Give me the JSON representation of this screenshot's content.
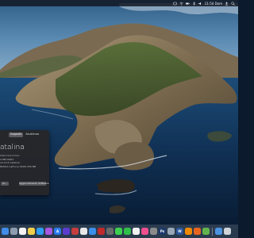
{
  "menubar": {
    "status_icons": [
      "control-icon",
      "wifi-icon",
      "battery-icon",
      "bluetooth-icon",
      "volume-icon",
      "user-icon",
      "spotlight-icon"
    ],
    "clock": "11:54 Dom"
  },
  "about_window": {
    "tabs": [
      "Supporto",
      "Assistenza"
    ],
    "os_name": "atalina",
    "specs": [
      "Intel Core 2 Duo",
      "4 MB DDR3",
      "10.15.6 Catalina",
      "NVIDIA GeForce 320M 256 MB"
    ],
    "button_report": "ts...",
    "button_update": "Aggiornamento Software..."
  },
  "dock": {
    "apps": [
      {
        "name": "finder",
        "color": "#3f8de8",
        "glyph": ""
      },
      {
        "name": "launchpad",
        "color": "#8f9db0",
        "glyph": ""
      },
      {
        "name": "calendar",
        "color": "#f4f4f4",
        "glyph": ""
      },
      {
        "name": "notes",
        "color": "#f0cf4a",
        "glyph": ""
      },
      {
        "name": "safari",
        "color": "#2f9df2",
        "glyph": ""
      },
      {
        "name": "podcasts",
        "color": "#a658e0",
        "glyph": ""
      },
      {
        "name": "app-store",
        "color": "#2a7cf0",
        "glyph": "A"
      },
      {
        "name": "siri",
        "color": "#5a3ccf",
        "glyph": ""
      },
      {
        "name": "photo-booth",
        "color": "#c53d3d",
        "glyph": ""
      },
      {
        "name": "chrome",
        "color": "#e8e8e8",
        "glyph": ""
      },
      {
        "name": "mail",
        "color": "#3a8ee8",
        "glyph": ""
      },
      {
        "name": "filezilla",
        "color": "#c02a2a",
        "glyph": ""
      },
      {
        "name": "grid",
        "color": "#6a6a6a",
        "glyph": ""
      },
      {
        "name": "messages",
        "color": "#3bd04f",
        "glyph": ""
      },
      {
        "name": "facetime",
        "color": "#2fbf4a",
        "glyph": ""
      },
      {
        "name": "photos",
        "color": "#f2f2f2",
        "glyph": ""
      },
      {
        "name": "itunes",
        "color": "#ef4f8f",
        "glyph": ""
      },
      {
        "name": "system-preferences",
        "color": "#8a8a8a",
        "glyph": ""
      },
      {
        "name": "photoshop",
        "color": "#1f3b6e",
        "glyph": "Ps"
      },
      {
        "name": "preview",
        "color": "#9aa7b6",
        "glyph": ""
      },
      {
        "name": "word",
        "color": "#2b579a",
        "glyph": "W"
      },
      {
        "name": "vlc",
        "color": "#f08a00",
        "glyph": ""
      },
      {
        "name": "firefox",
        "color": "#e8651f",
        "glyph": ""
      },
      {
        "name": "maps",
        "color": "#63b34d",
        "glyph": ""
      }
    ],
    "trailing": [
      {
        "name": "downloads",
        "color": "#4a93e0",
        "glyph": ""
      },
      {
        "name": "trash",
        "color": "#cfd3d8",
        "glyph": ""
      }
    ]
  }
}
